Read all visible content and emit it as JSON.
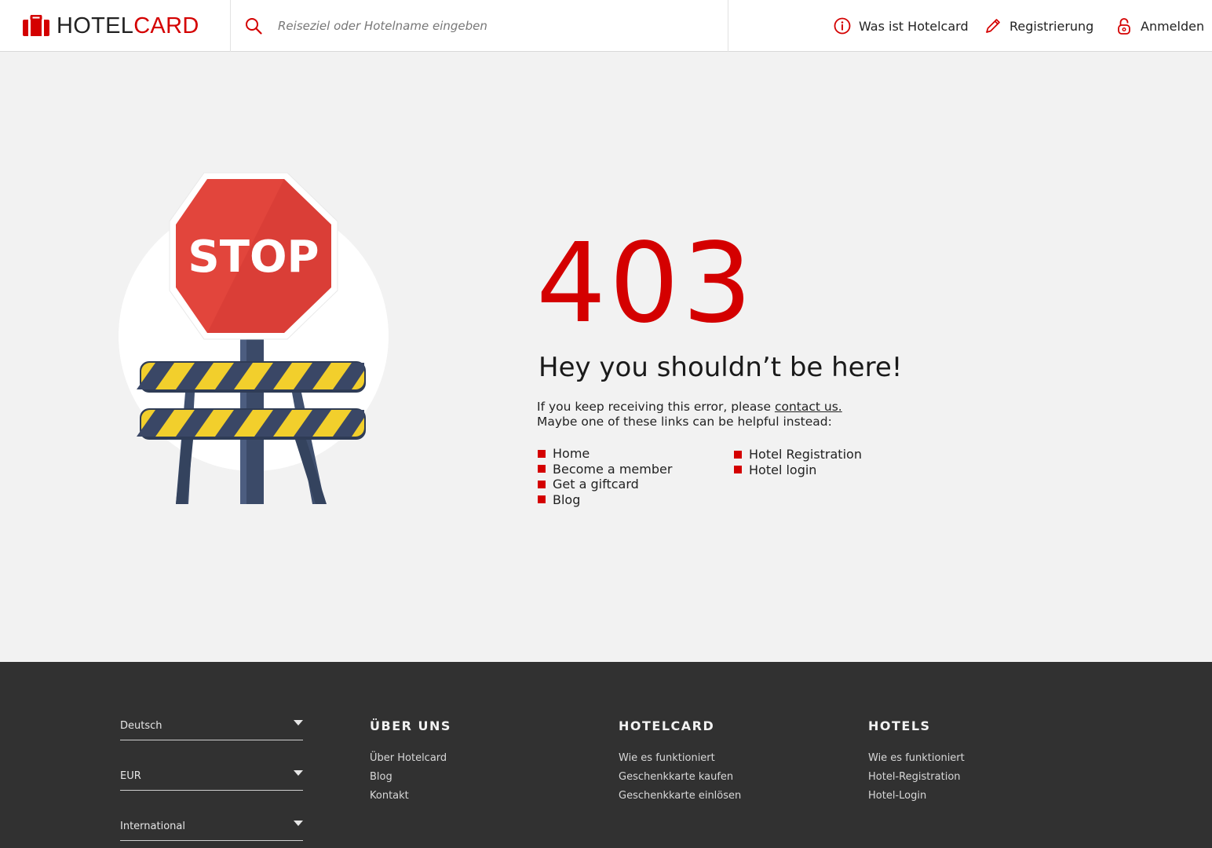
{
  "brand": {
    "hotel": "HOTEL",
    "card": "CARD",
    "accent": "#d40000"
  },
  "search": {
    "placeholder": "Reiseziel oder Hotelname eingeben",
    "icon": "search-icon"
  },
  "nav": {
    "items": [
      {
        "label": "Was ist Hotelcard",
        "icon": "info-icon"
      },
      {
        "label": "Registrierung",
        "icon": "pencil-icon"
      },
      {
        "label": "Anmelden",
        "icon": "lock-icon"
      }
    ]
  },
  "illustration": {
    "sign_text": "STOP"
  },
  "error": {
    "code": "403",
    "headline": "Hey you shouldn’t be here!",
    "message_prefix": "If you keep receiving this error, please ",
    "contact_link": "contact us.",
    "message_line2": "Maybe one of these links can be helpful instead:"
  },
  "links": {
    "left": [
      "Home",
      "Become a member",
      "Get a giftcard",
      "Blog"
    ],
    "right": [
      "Hotel Registration",
      "Hotel login"
    ]
  },
  "footer": {
    "selects": [
      "Deutsch",
      "EUR",
      "International"
    ],
    "columns": [
      {
        "title": "ÜBER UNS",
        "links": [
          "Über Hotelcard",
          "Blog",
          "Kontakt"
        ]
      },
      {
        "title": "HOTELCARD",
        "links": [
          "Wie es funktioniert",
          "Geschenkkarte kaufen",
          "Geschenkkarte einlösen"
        ]
      },
      {
        "title": "HOTELS",
        "links": [
          "Wie es funktioniert",
          "Hotel-Registration",
          "Hotel-Login"
        ]
      }
    ]
  }
}
